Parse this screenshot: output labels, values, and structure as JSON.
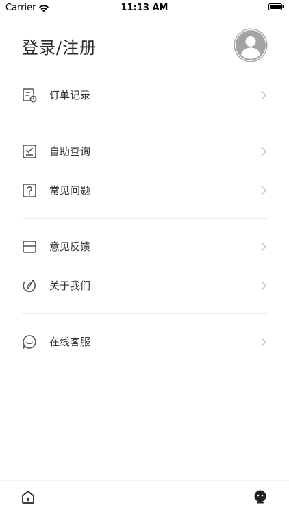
{
  "status_bar": {
    "carrier": "Carrier",
    "time": "11:13 AM"
  },
  "header": {
    "title": "登录/注册"
  },
  "menu": {
    "groups": [
      [
        {
          "label": "订单记录",
          "icon": "order-record-icon"
        }
      ],
      [
        {
          "label": "自助查询",
          "icon": "self-query-icon"
        },
        {
          "label": "常见问题",
          "icon": "faq-icon"
        }
      ],
      [
        {
          "label": "意见反馈",
          "icon": "feedback-icon"
        },
        {
          "label": "关于我们",
          "icon": "about-icon"
        }
      ],
      [
        {
          "label": "在线客服",
          "icon": "customer-service-icon"
        }
      ]
    ]
  },
  "tabbar": {
    "items": [
      {
        "icon": "home-icon"
      },
      {
        "icon": "mine-icon",
        "selected": true
      }
    ]
  },
  "colors": {
    "icon": "#555555",
    "chevron": "#c7c7cc",
    "divider": "#ececec",
    "avatar_bg": "#a3a3a3"
  }
}
